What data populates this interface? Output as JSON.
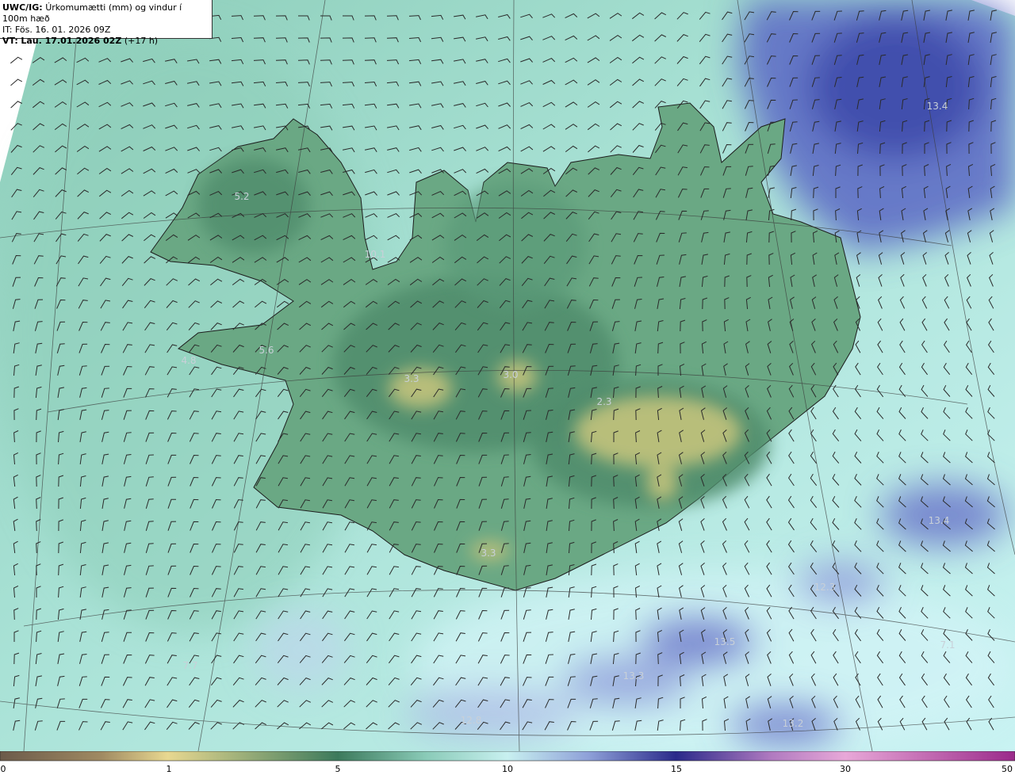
{
  "header": {
    "product_prefix": "UWC/IG:",
    "product_title": "Úrkomumætti (mm) og vindur í 100m hæð",
    "issue_time": "IT: Fös. 16. 01. 2026 09Z",
    "valid_prefix": "VT:",
    "valid_time": "Lau. 17.01.2026 02Z",
    "valid_offset": "(+17 h)"
  },
  "map_labels": [
    "5.2",
    "10.1",
    "5.6",
    "4.8",
    "3.3",
    "3.0",
    "2.3",
    "3.3",
    "13.4",
    "13.4",
    "12.3",
    "13.5",
    "13.3",
    "7.1",
    "7.7",
    "12.8",
    "13.2"
  ],
  "scale": {
    "tick_labels": [
      "0",
      "1",
      "5",
      "10",
      "15",
      "30",
      "50"
    ],
    "colors": [
      "#6b5a4a",
      "#a08a62",
      "#e8d890",
      "#3c7a5c",
      "#8acbb8",
      "#c8f0f0",
      "#8ea0d8",
      "#2a2a8a",
      "#b07ac0",
      "#e8a8d8",
      "#9a2a8a"
    ]
  },
  "colors": {
    "sea_light": "#bfeeee",
    "sea_mid": "#94d8cc",
    "land_green": "#5e9a78",
    "land_dark": "#3f7a5c",
    "glacier_yellow": "#b8c080",
    "precip_blue": "#7f88d8",
    "precip_dark": "#3a44a8"
  }
}
